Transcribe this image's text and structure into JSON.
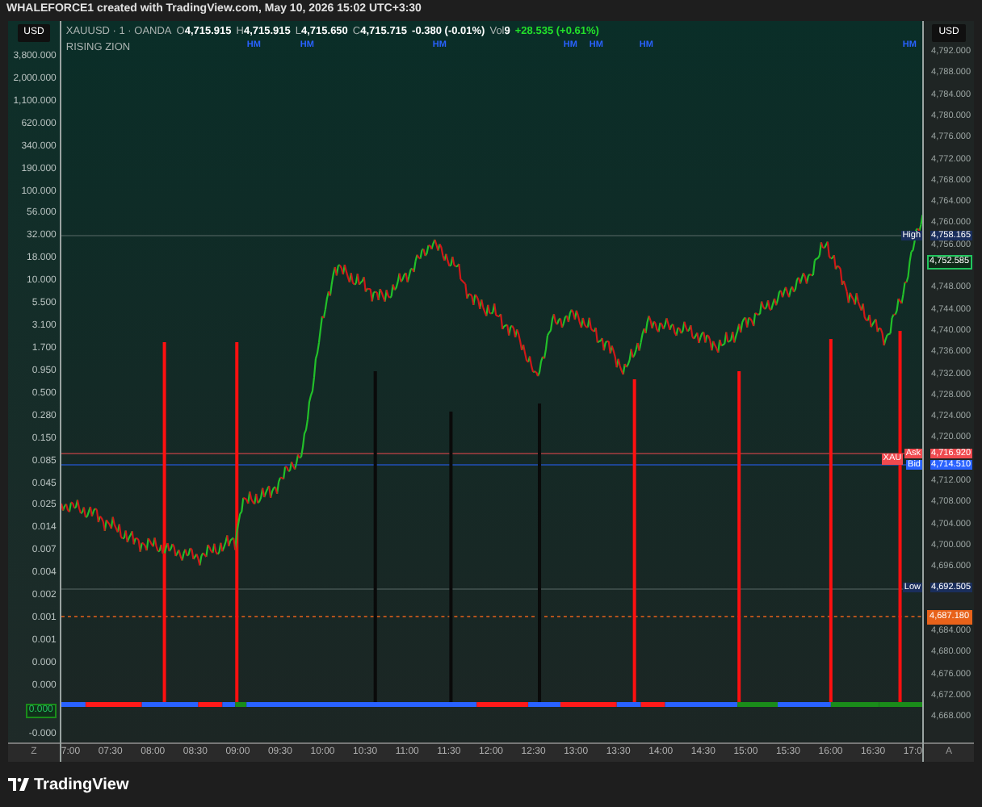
{
  "header": {
    "title": "WHALEFORCE1 created with TradingView.com, May 10, 2026 15:02 UTC+3:30"
  },
  "chart": {
    "left_currency": "USD",
    "right_currency": "USD",
    "legend": {
      "symbol": "XAUUSD · 1 · OANDA",
      "ohlc": [
        {
          "label": "O",
          "value": "4,715.915"
        },
        {
          "label": "H",
          "value": "4,715.915"
        },
        {
          "label": "L",
          "value": "4,715.650"
        },
        {
          "label": "C",
          "value": "4,715.715"
        }
      ],
      "change": "-0.380 (-0.01%)",
      "volume_label": "Vol",
      "volume": "9",
      "day_change": "+28.535 (+0.61%)"
    },
    "indicator": "RISING ZION",
    "markers": [
      "HM",
      "HM",
      "HM",
      "HM",
      "HM",
      "HM",
      "HM"
    ],
    "left_axis": [
      {
        "text": "3,800.000",
        "kind": "label"
      },
      {
        "text": "2,000.000",
        "kind": "label"
      },
      {
        "text": "1,100.000",
        "kind": "label"
      },
      {
        "text": "620.000",
        "kind": "label"
      },
      {
        "text": "340.000",
        "kind": "label"
      },
      {
        "text": "190.000",
        "kind": "label"
      },
      {
        "text": "100.000",
        "kind": "label"
      },
      {
        "text": "56.000",
        "kind": "label"
      },
      {
        "text": "32.000",
        "kind": "label"
      },
      {
        "text": "18.000",
        "kind": "label"
      },
      {
        "text": "10.000",
        "kind": "label"
      },
      {
        "text": "5.500",
        "kind": "label"
      },
      {
        "text": "3.100",
        "kind": "label"
      },
      {
        "text": "1.700",
        "kind": "label"
      },
      {
        "text": "0.950",
        "kind": "label"
      },
      {
        "text": "0.500",
        "kind": "label"
      },
      {
        "text": "0.280",
        "kind": "label"
      },
      {
        "text": "0.150",
        "kind": "label"
      },
      {
        "text": "0.085",
        "kind": "label"
      },
      {
        "text": "0.045",
        "kind": "label"
      },
      {
        "text": "0.025",
        "kind": "label"
      },
      {
        "text": "0.014",
        "kind": "label"
      },
      {
        "text": "0.007",
        "kind": "label"
      },
      {
        "text": "0.004",
        "kind": "label"
      },
      {
        "text": "0.002",
        "kind": "label"
      },
      {
        "text": "0.001",
        "kind": "label"
      },
      {
        "text": "0.001",
        "kind": "label"
      },
      {
        "text": "0.000",
        "kind": "label"
      },
      {
        "text": "0.000",
        "kind": "label"
      },
      {
        "text": "0.000",
        "kind": "tag"
      },
      {
        "text": "-0.000",
        "kind": "label"
      }
    ],
    "right_axis": [
      "4,792.000",
      "4,788.000",
      "4,784.000",
      "4,780.000",
      "4,776.000",
      "4,772.000",
      "4,768.000",
      "4,764.000",
      "4,760.000",
      "4,756.000",
      "4,748.000",
      "4,744.000",
      "4,740.000",
      "4,736.000",
      "4,732.000",
      "4,728.000",
      "4,724.000",
      "4,720.000",
      "4,712.000",
      "4,708.000",
      "4,704.000",
      "4,700.000",
      "4,696.000",
      "4,684.000",
      "4,680.000",
      "4,676.000",
      "4,672.000",
      "4,668.000"
    ],
    "price_tags": [
      {
        "label": "High",
        "value": "4,758.165",
        "color": "#1a2e5c"
      },
      {
        "value": "4,752.585",
        "color": "#22c55e"
      },
      {
        "label": "Ask",
        "value": "4,716.920",
        "color": "#f04a4f"
      },
      {
        "label": "Bid",
        "value": "4,714.510",
        "color": "#2962ff"
      },
      {
        "label": "Low",
        "value": "4,692.505",
        "color": "#1a2e5c"
      },
      {
        "value": "4,687.180",
        "color": "#e8621a"
      }
    ],
    "symbol_tag": "XAU",
    "time_axis": {
      "left": "Z",
      "ticks": [
        "7:00",
        "07:30",
        "08:00",
        "08:30",
        "09:00",
        "09:30",
        "10:00",
        "10:30",
        "11:00",
        "11:30",
        "12:00",
        "12:30",
        "13:00",
        "13:30",
        "14:00",
        "14:30",
        "15:00",
        "15:30",
        "16:00",
        "16:30",
        "17:0"
      ],
      "right": "A"
    }
  },
  "footer": {
    "logo": "TradingView"
  }
}
